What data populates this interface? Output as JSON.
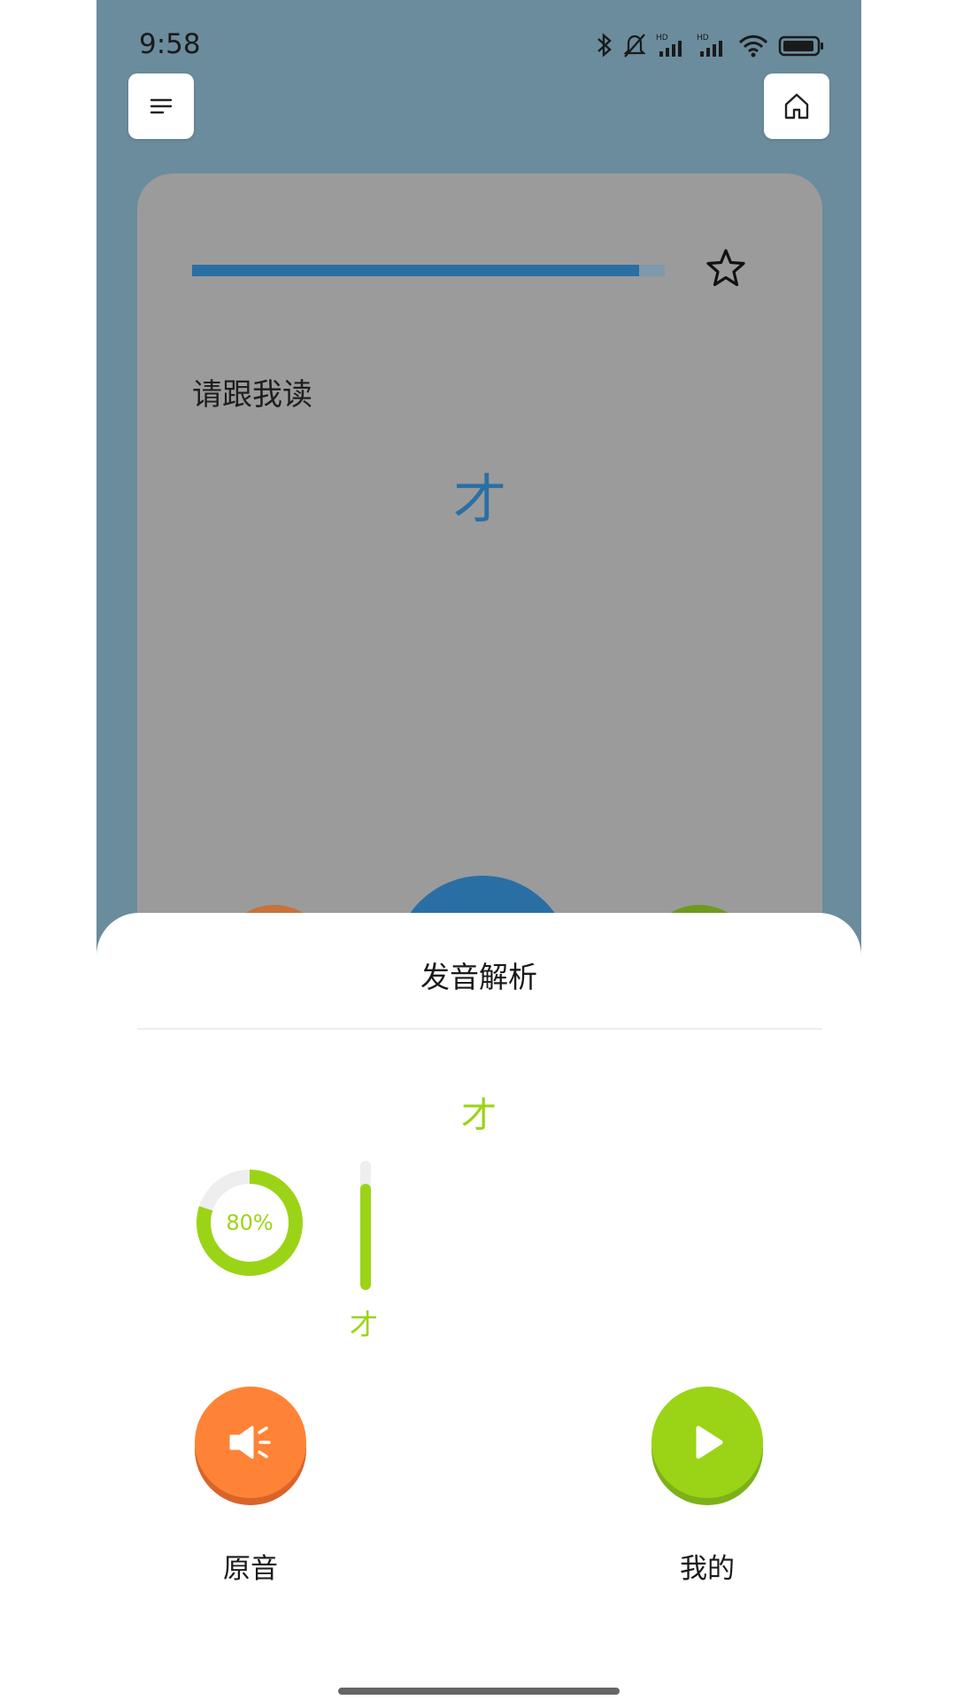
{
  "status_bar": {
    "time": "9:58",
    "icons": [
      "bluetooth-icon",
      "mute-icon",
      "signal-hd-icon",
      "signal-hd-icon",
      "wifi-icon",
      "battery-icon"
    ]
  },
  "top_bar": {
    "menu_icon": "menu-icon",
    "home_icon": "home-icon"
  },
  "card": {
    "progress": 0.945,
    "instruction": "请跟我读",
    "character": "才",
    "favorite_icon": "star-outline-icon"
  },
  "sheet": {
    "title": "发音解析",
    "character": "才",
    "score": 0.8,
    "score_text": "80%",
    "char_scores": [
      {
        "char": "才",
        "level": 0.82
      }
    ],
    "original_button": {
      "label": "原音",
      "icon": "speaker-icon"
    },
    "mine_button": {
      "label": "我的",
      "icon": "play-icon"
    }
  },
  "colors": {
    "accent_blue": "#2a6fa4",
    "accent_green": "#9bd416",
    "accent_orange": "#ff8336",
    "background": "#6b8c9c"
  }
}
